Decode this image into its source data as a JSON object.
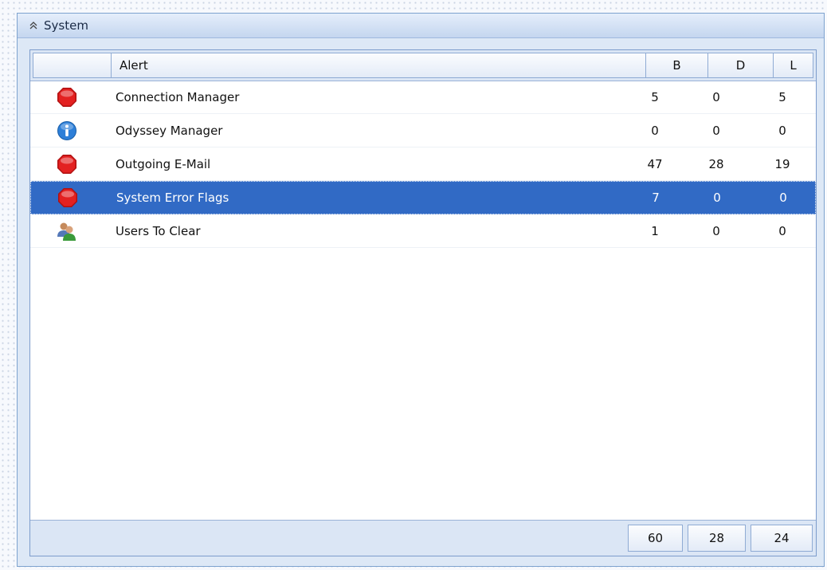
{
  "panel": {
    "title": "System",
    "collapse_icon": "double-chevron-up-icon"
  },
  "grid": {
    "columns": [
      {
        "key": "icon",
        "label": ""
      },
      {
        "key": "alert",
        "label": "Alert"
      },
      {
        "key": "b",
        "label": "B"
      },
      {
        "key": "d",
        "label": "D"
      },
      {
        "key": "l",
        "label": "L"
      }
    ],
    "rows": [
      {
        "icon": "stop-icon",
        "alert": "Connection Manager",
        "b": "5",
        "d": "0",
        "l": "5",
        "selected": false
      },
      {
        "icon": "info-icon",
        "alert": "Odyssey Manager",
        "b": "0",
        "d": "0",
        "l": "0",
        "selected": false
      },
      {
        "icon": "stop-icon",
        "alert": "Outgoing E-Mail",
        "b": "47",
        "d": "28",
        "l": "19",
        "selected": false
      },
      {
        "icon": "stop-icon",
        "alert": "System Error Flags",
        "b": "7",
        "d": "0",
        "l": "0",
        "selected": true
      },
      {
        "icon": "users-icon",
        "alert": "Users To Clear",
        "b": "1",
        "d": "0",
        "l": "0",
        "selected": false
      }
    ],
    "totals": {
      "b": "60",
      "d": "28",
      "l": "24"
    }
  },
  "colors": {
    "selection": "#316ac5",
    "stop": "#d61a1a",
    "info": "#2d7fd8",
    "panel_border": "#7da2ce"
  }
}
